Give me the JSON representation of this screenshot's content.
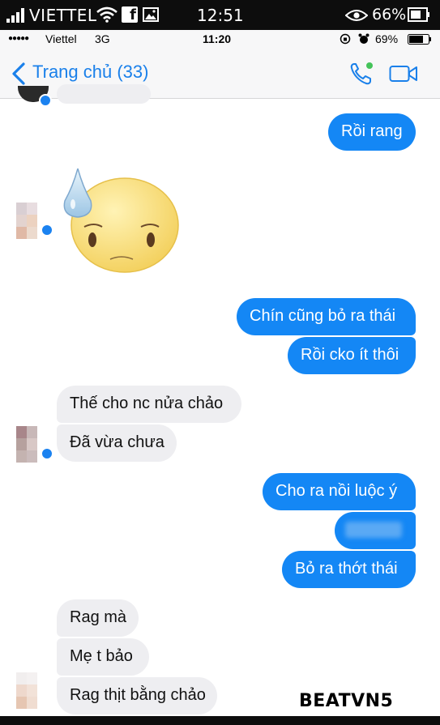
{
  "outer_status": {
    "carrier": "VIETTEL",
    "time": "12:51",
    "battery": "66%",
    "fb_icon": "f"
  },
  "ios_status": {
    "signal_dots": "●●●●●",
    "carrier": "Viettel",
    "network": "3G",
    "time": "11:20",
    "battery": "69%"
  },
  "nav": {
    "back_label": "Trang chủ (33)",
    "icons": [
      "chevron-left-icon",
      "phone-icon",
      "video-camera-icon"
    ]
  },
  "colors": {
    "accent": "#1487f5",
    "incoming_bubble": "#eeeef1",
    "nav_bg": "#f7f7f8"
  },
  "messages": [
    {
      "side": "out",
      "text": "Rồi rang"
    },
    {
      "side": "in",
      "type": "sticker",
      "sticker": "sweat-face-sticker"
    },
    {
      "side": "out",
      "text": "Chín cũng bỏ ra thái"
    },
    {
      "side": "out",
      "text": "Rồi cko ít thôi"
    },
    {
      "side": "in",
      "text": "Thế cho nc nửa chảo"
    },
    {
      "side": "in",
      "text": "Đã vừa chưa"
    },
    {
      "side": "out",
      "text": "Cho ra nồi luộc ý"
    },
    {
      "side": "out",
      "text": "",
      "blurred": true
    },
    {
      "side": "out",
      "text": "Bỏ ra thớt thái"
    },
    {
      "side": "in",
      "text": "Rag mà"
    },
    {
      "side": "in",
      "text": "Mẹ t bảo"
    },
    {
      "side": "in",
      "text": "Rag thịt bằng chảo"
    }
  ],
  "watermark": "BEATVN5"
}
